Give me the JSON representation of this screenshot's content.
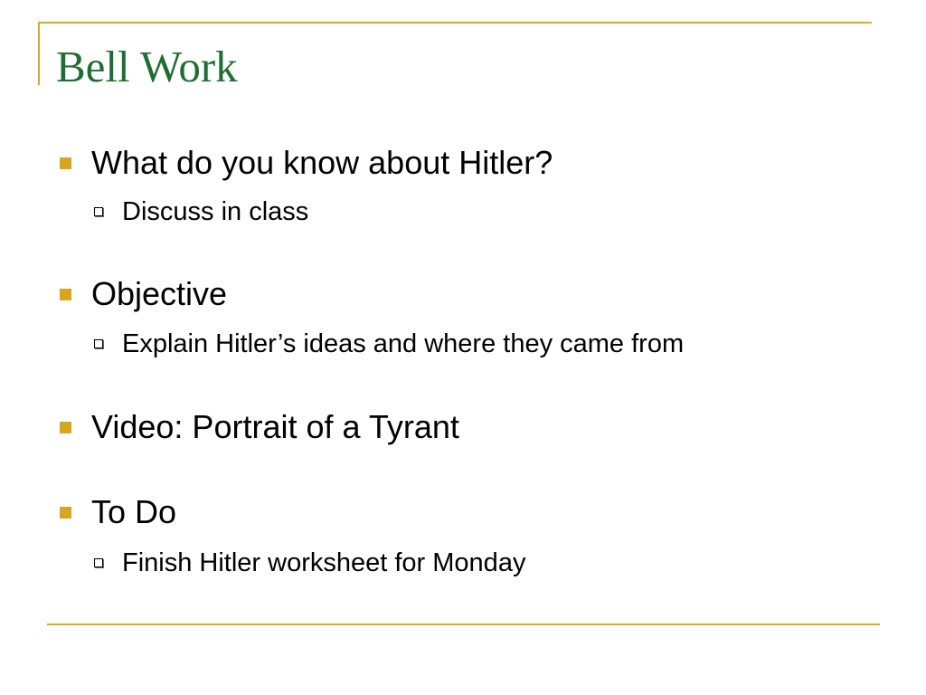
{
  "slide": {
    "title": "Bell Work",
    "bullets": [
      {
        "text": "What do you know about Hitler?",
        "subitems": [
          "Discuss in class"
        ]
      },
      {
        "text": "Objective",
        "subitems": [
          "Explain Hitler’s ideas and where they came from"
        ]
      },
      {
        "text": "Video:  Portrait of a Tyrant",
        "subitems": []
      },
      {
        "text": "To Do",
        "subitems": [
          "Finish Hitler worksheet for Monday"
        ]
      }
    ]
  },
  "colors": {
    "title": "#1f6d33",
    "accent_rule": "#dba827",
    "bullet": "#d8a51f",
    "text": "#000000",
    "background": "#ffffff"
  },
  "icons": {
    "level1_bullet": "square-bullet-icon",
    "level2_bullet": "hollow-square-bullet-icon"
  }
}
